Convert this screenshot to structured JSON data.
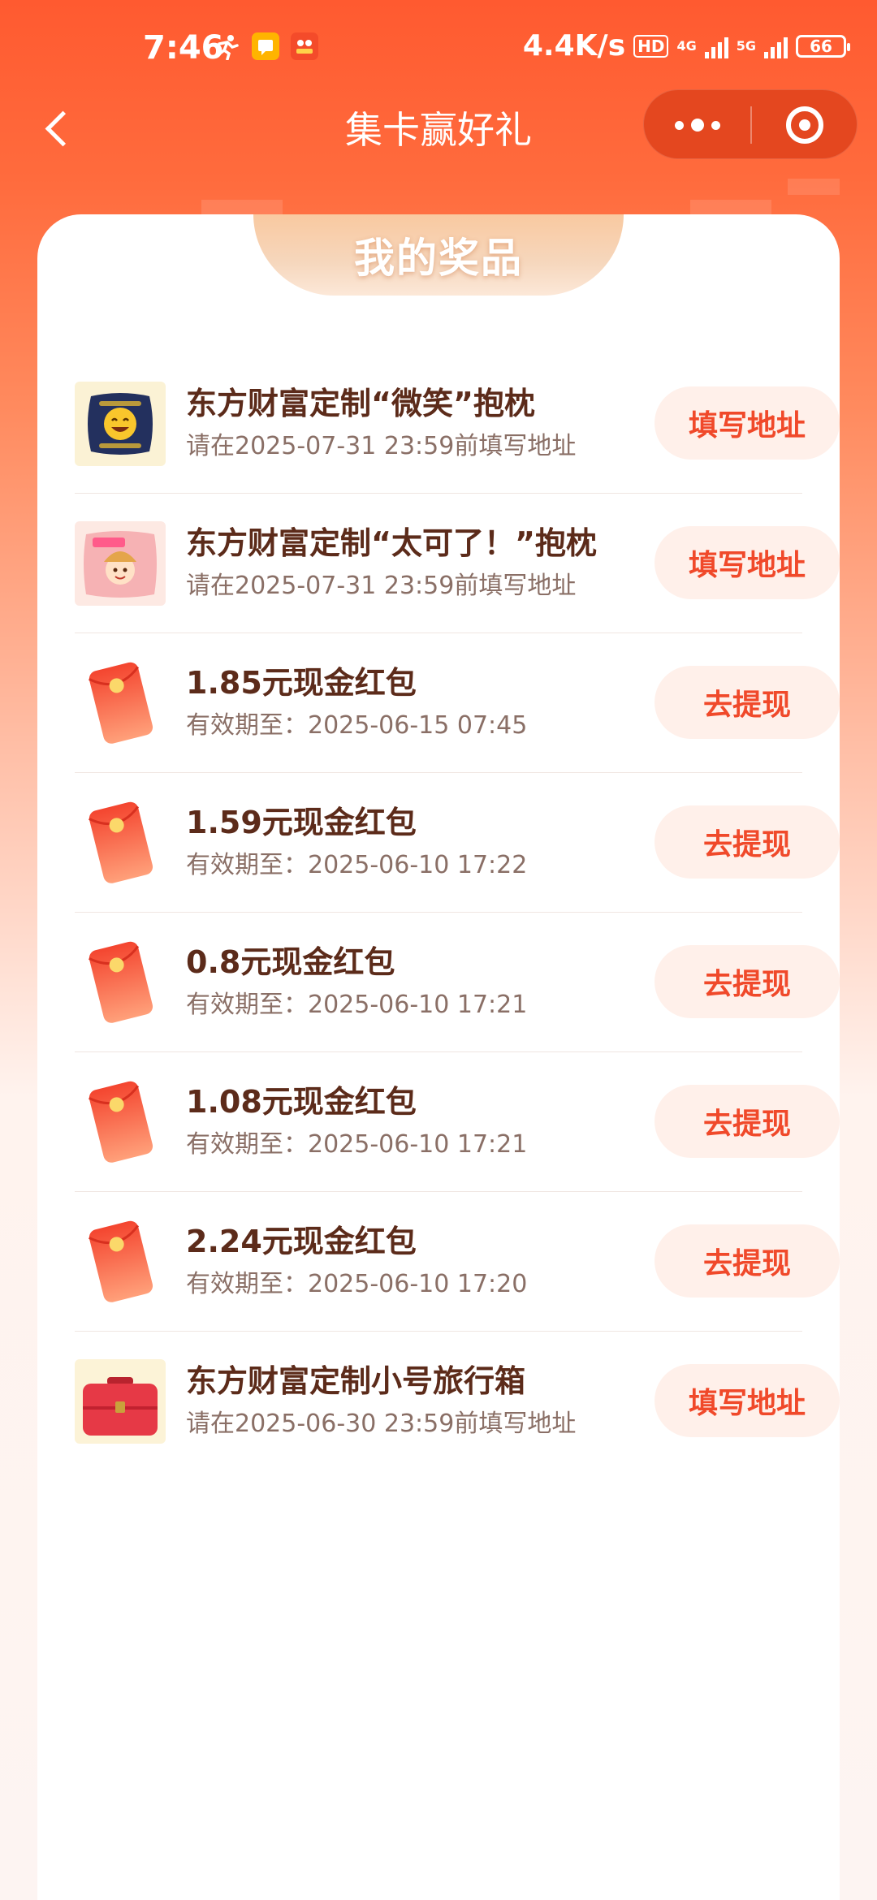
{
  "status_bar": {
    "time": "7:46",
    "speed": "4.4K/s",
    "hd": "HD",
    "net1": "4G",
    "net2": "5G",
    "battery": "66"
  },
  "nav": {
    "title": "集卡赢好礼"
  },
  "card": {
    "title": "我的奖品"
  },
  "prizes": [
    {
      "name": "东方财富定制“微笑”抱枕",
      "sub": "请在2025-07-31 23:59前填写地址",
      "action": "填写地址",
      "icon": "pillow-icon"
    },
    {
      "name": "东方财富定制“太可了！”抱枕",
      "sub": "请在2025-07-31 23:59前填写地址",
      "action": "填写地址",
      "icon": "pillow-icon"
    },
    {
      "name": "1.85元现金红包",
      "sub": "有效期至：2025-06-15 07:45",
      "action": "去提现",
      "icon": "red-envelope-icon"
    },
    {
      "name": "1.59元现金红包",
      "sub": "有效期至：2025-06-10 17:22",
      "action": "去提现",
      "icon": "red-envelope-icon"
    },
    {
      "name": "0.8元现金红包",
      "sub": "有效期至：2025-06-10 17:21",
      "action": "去提现",
      "icon": "red-envelope-icon"
    },
    {
      "name": "1.08元现金红包",
      "sub": "有效期至：2025-06-10 17:21",
      "action": "去提现",
      "icon": "red-envelope-icon"
    },
    {
      "name": "2.24元现金红包",
      "sub": "有效期至：2025-06-10 17:20",
      "action": "去提现",
      "icon": "red-envelope-icon"
    },
    {
      "name": "东方财富定制小号旅行箱",
      "sub": "请在2025-06-30 23:59前填写地址",
      "action": "填写地址",
      "icon": "suitcase-icon"
    }
  ],
  "colors": {
    "accent": "#f0492a",
    "header_bg": "#ff5a30",
    "button_bg": "#fff0ea",
    "title_text": "#5c2b1a"
  }
}
